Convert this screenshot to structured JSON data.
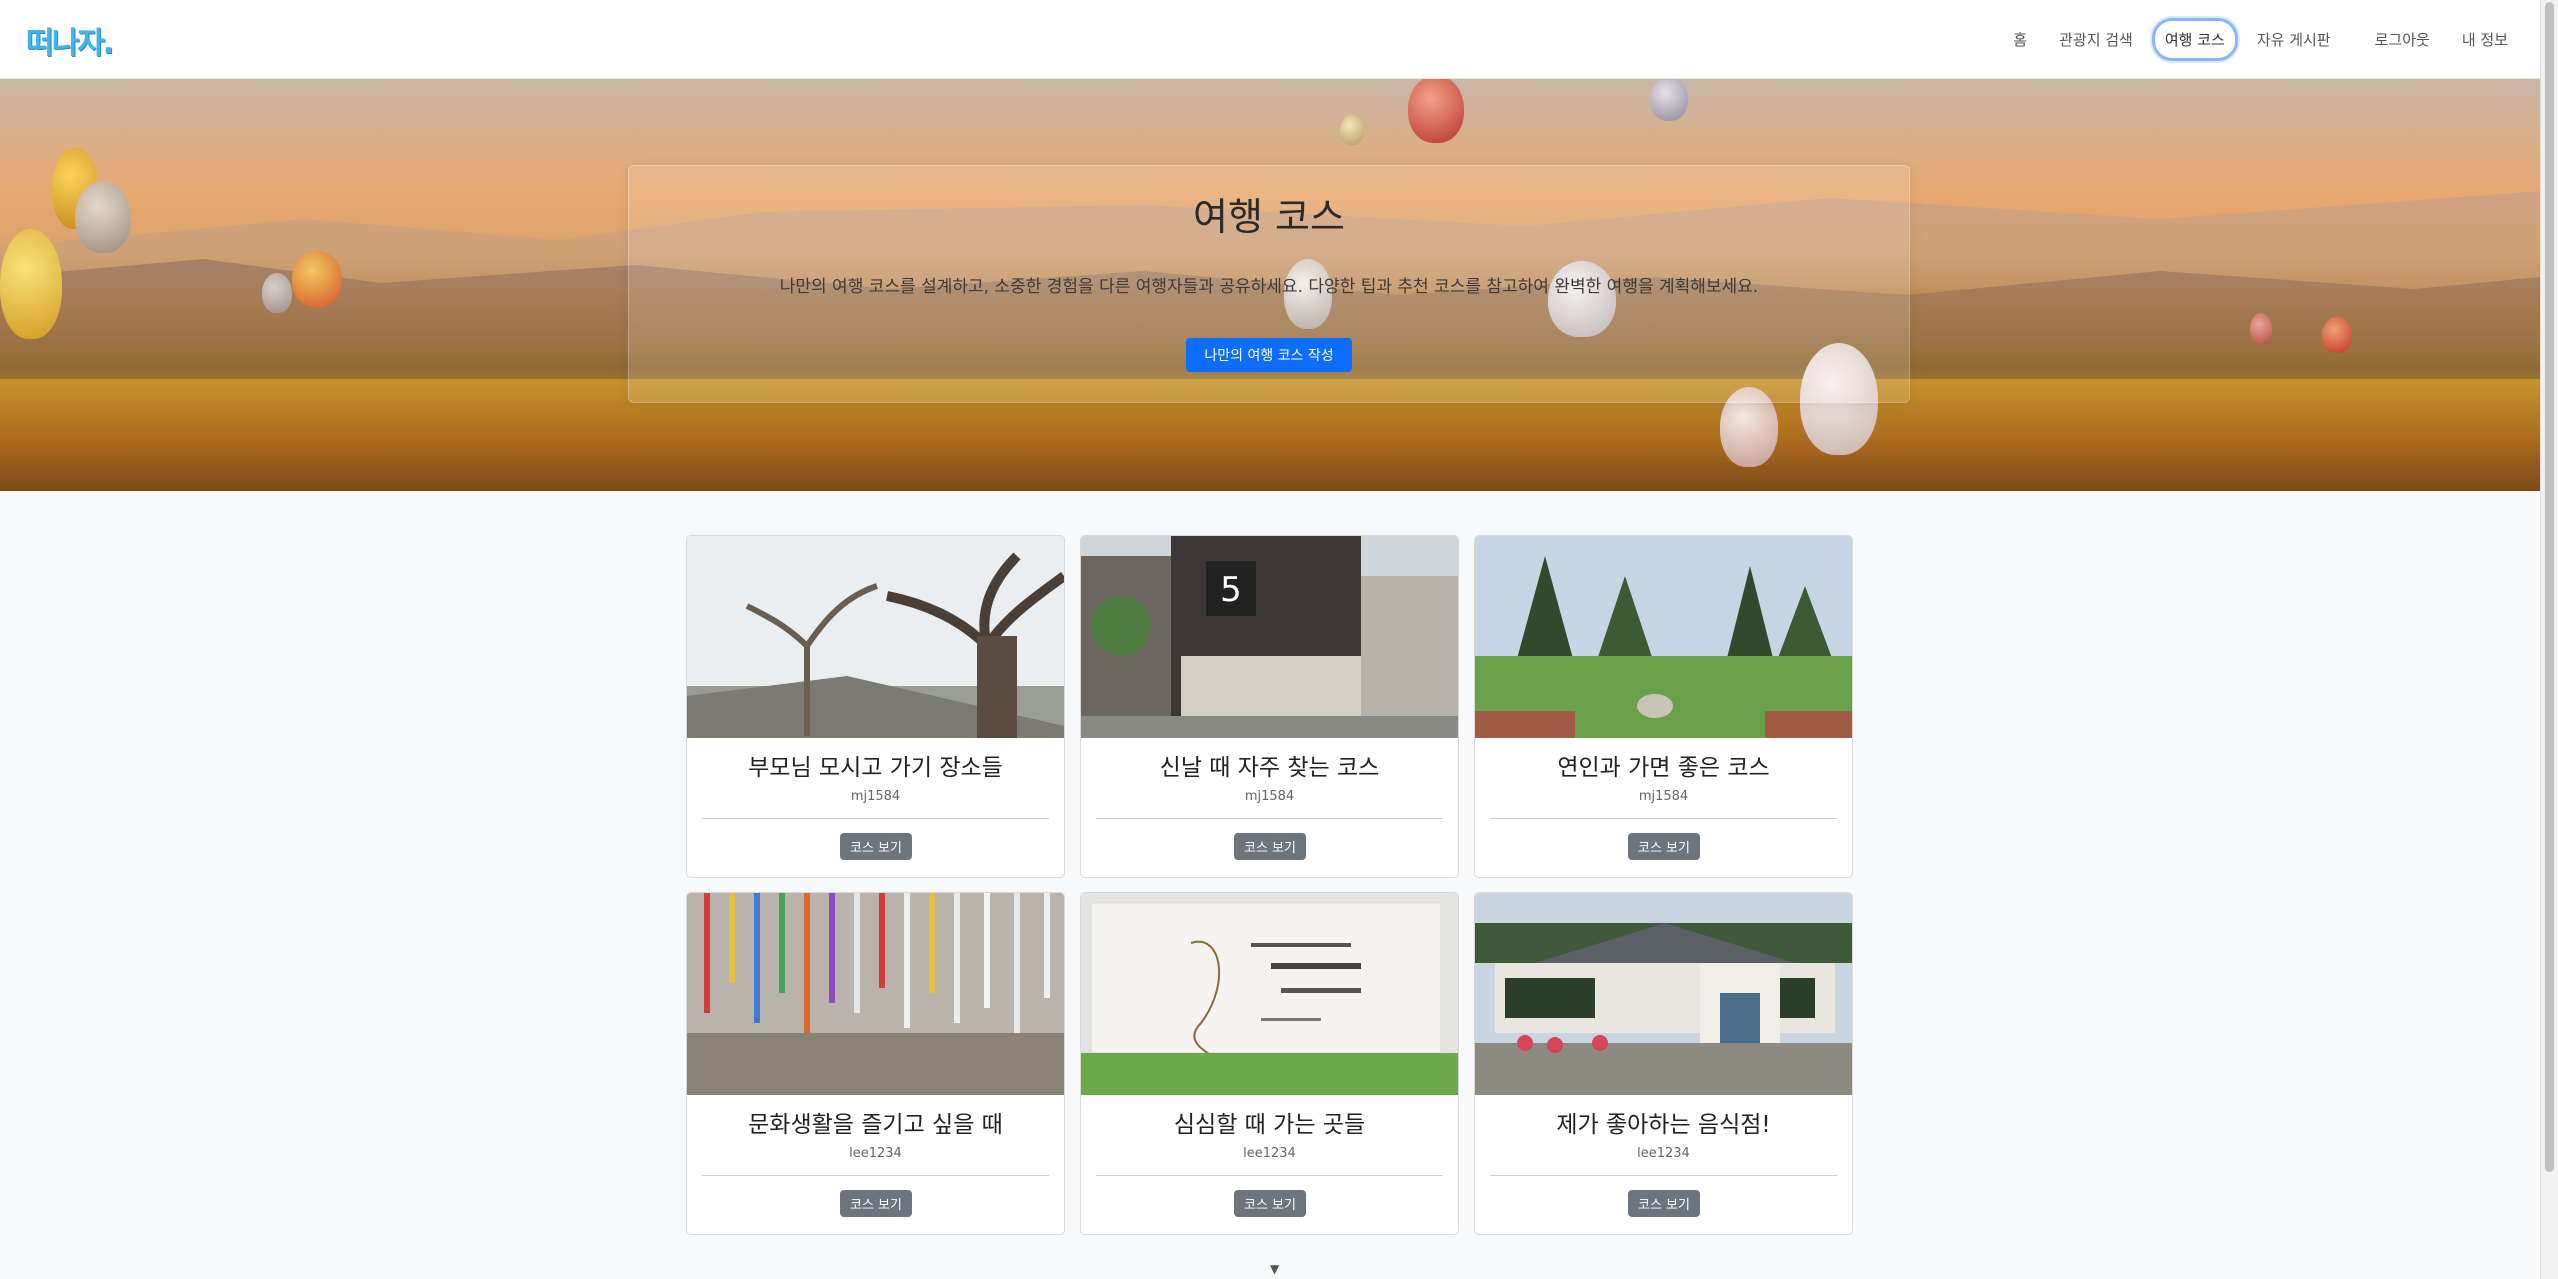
{
  "brand": {
    "logo_text": "떠나자."
  },
  "nav": {
    "items": [
      {
        "label": "홈"
      },
      {
        "label": "관광지 검색"
      },
      {
        "label": "여행 코스",
        "active": true
      },
      {
        "label": "자유 게시판"
      },
      {
        "label": "로그아웃"
      },
      {
        "label": "내 정보"
      }
    ]
  },
  "hero": {
    "title": "여행 코스",
    "description": "나만의 여행 코스를 설계하고, 소중한 경험을 다른 여행자들과 공유하세요. 다양한 팁과 추천 코스를 참고하여 완벽한 여행을 계획해보세요.",
    "cta_label": "나만의 여행 코스 작성"
  },
  "courses": [
    {
      "title": "부모님 모시고 가기 장소들",
      "author": "mj1584",
      "button": "코스 보기"
    },
    {
      "title": "신날 때 자주 찾는 코스",
      "author": "mj1584",
      "button": "코스 보기"
    },
    {
      "title": "연인과 가면 좋은 코스",
      "author": "mj1584",
      "button": "코스 보기"
    },
    {
      "title": "문화생활을 즐기고 싶을 때",
      "author": "lee1234",
      "button": "코스 보기"
    },
    {
      "title": "심심할 때 가는 곳들",
      "author": "lee1234",
      "button": "코스 보기"
    },
    {
      "title": "제가 좋아하는 음식점!",
      "author": "lee1234",
      "button": "코스 보기"
    }
  ],
  "colors": {
    "brand": "#41b4ea",
    "primary": "#0d6efd",
    "secondary": "#6c757d"
  }
}
